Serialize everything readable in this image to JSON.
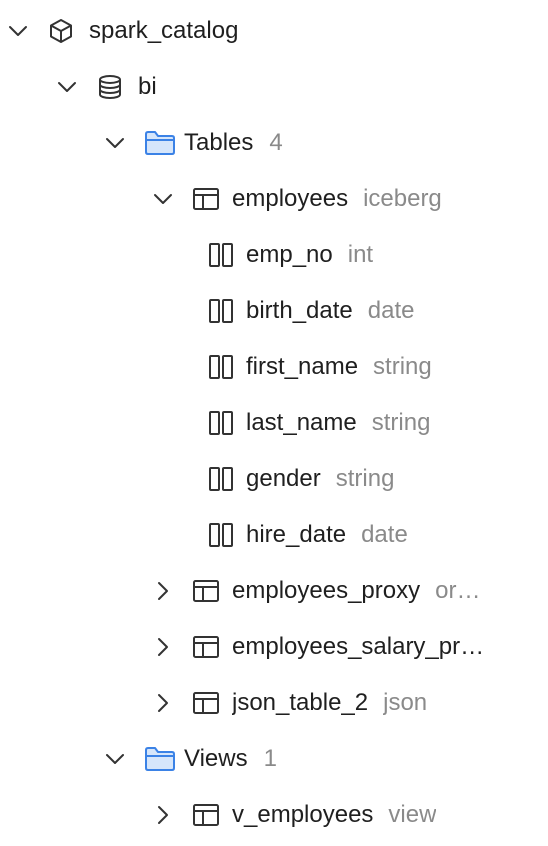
{
  "tree": {
    "catalog": {
      "label": "spark_catalog",
      "icon": "cube-icon",
      "expanded": true
    },
    "database": {
      "label": "bi",
      "icon": "database-icon",
      "expanded": true
    },
    "tables_folder": {
      "label": "Tables",
      "count": "4",
      "icon": "folder-icon",
      "expanded": true
    },
    "tables": [
      {
        "label": "employees",
        "type": "iceberg",
        "expanded": true,
        "columns": [
          {
            "name": "emp_no",
            "type": "int"
          },
          {
            "name": "birth_date",
            "type": "date"
          },
          {
            "name": "first_name",
            "type": "string"
          },
          {
            "name": "last_name",
            "type": "string"
          },
          {
            "name": "gender",
            "type": "string"
          },
          {
            "name": "hire_date",
            "type": "date"
          }
        ]
      },
      {
        "label": "employees_proxy",
        "type": "or…",
        "expanded": false
      },
      {
        "label": "employees_salary_pr…",
        "type": "",
        "expanded": false
      },
      {
        "label": "json_table_2",
        "type": "json",
        "expanded": false
      }
    ],
    "views_folder": {
      "label": "Views",
      "count": "1",
      "icon": "folder-icon",
      "expanded": true
    },
    "views": [
      {
        "label": "v_employees",
        "type": "view",
        "expanded": false
      }
    ]
  }
}
